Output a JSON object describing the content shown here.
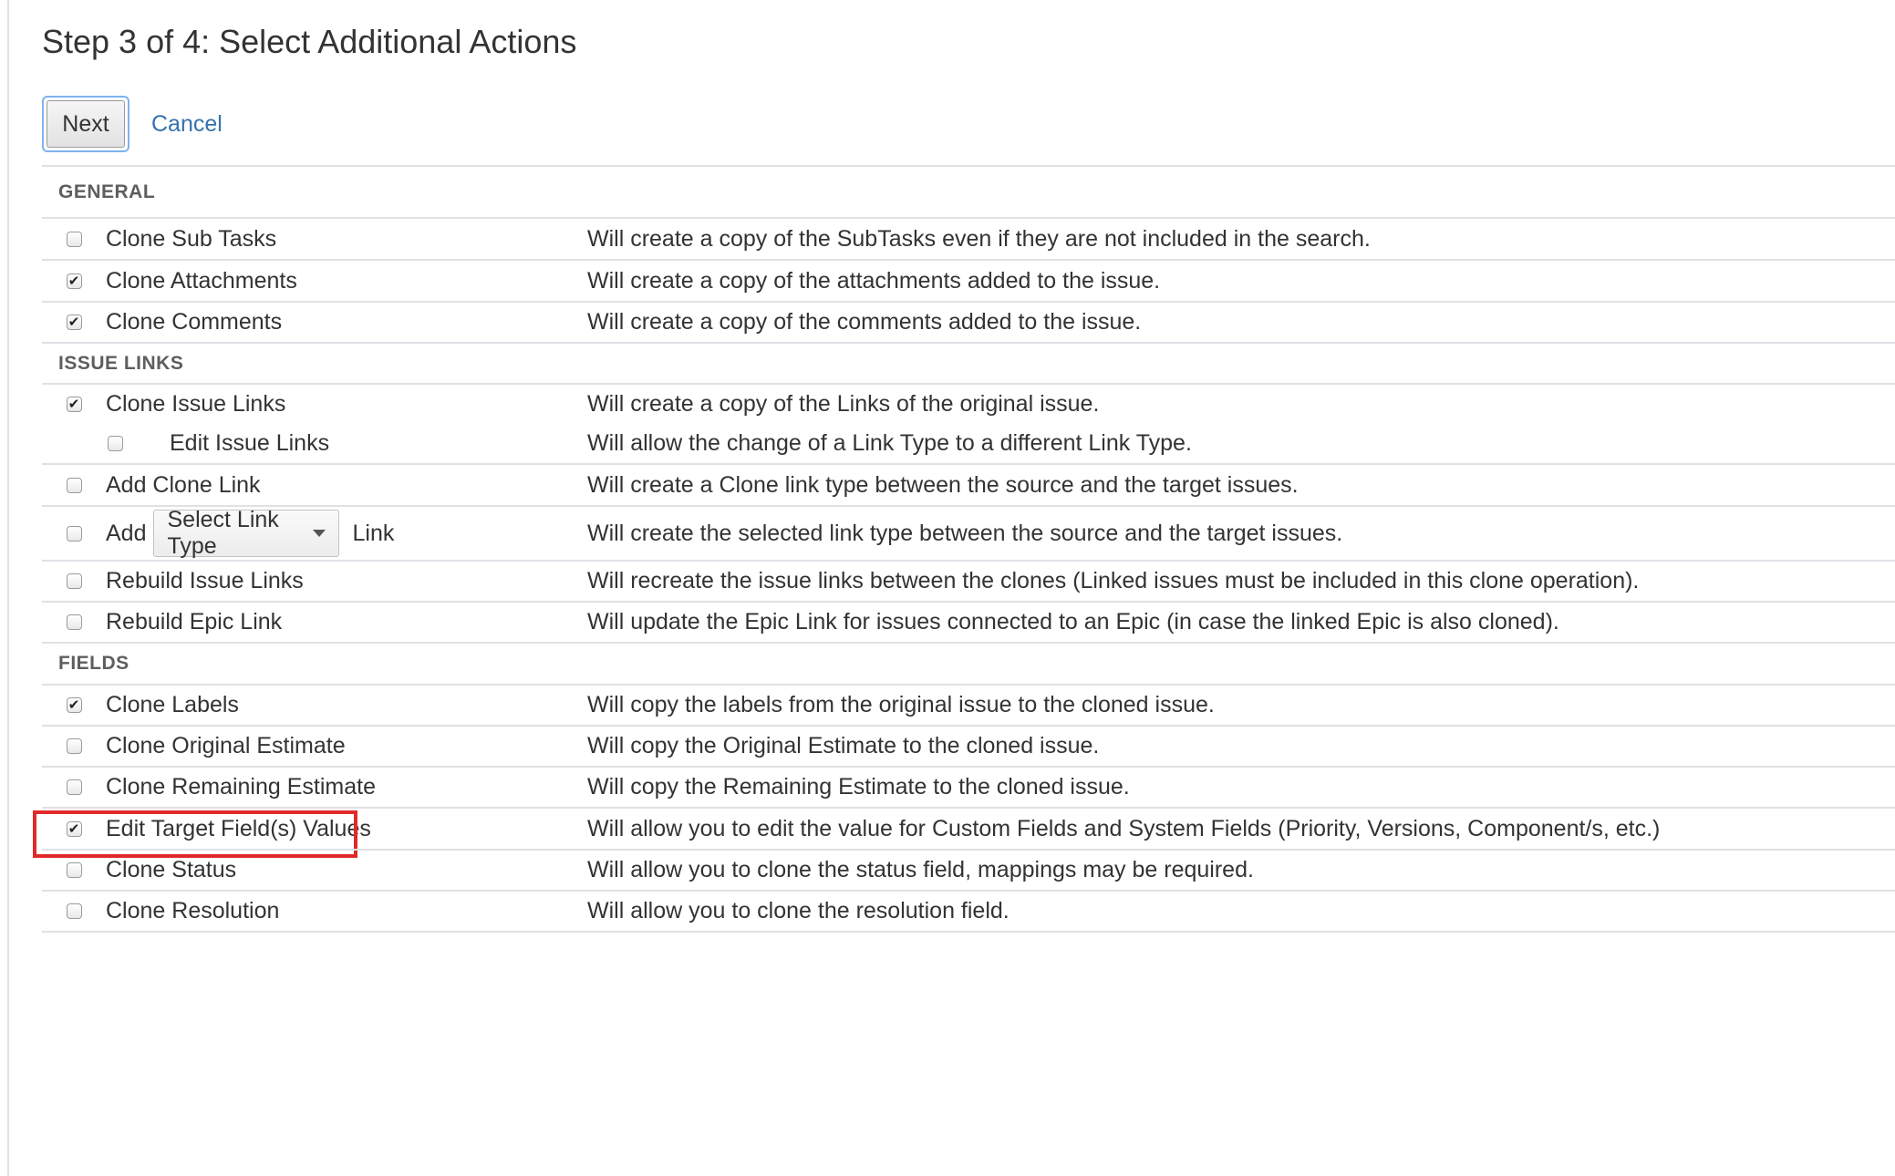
{
  "page": {
    "title": "Step 3 of 4: Select Additional Actions"
  },
  "actions": {
    "next_label": "Next",
    "cancel_label": "Cancel"
  },
  "sections": {
    "general": {
      "header": "GENERAL",
      "rows": [
        {
          "label": "Clone Sub Tasks",
          "checked": false,
          "description": "Will create a copy of the SubTasks even if they are not included in the search."
        },
        {
          "label": "Clone Attachments",
          "checked": true,
          "description": "Will create a copy of the attachments added to the issue."
        },
        {
          "label": "Clone Comments",
          "checked": true,
          "description": "Will create a copy of the comments added to the issue."
        }
      ]
    },
    "issue_links": {
      "header": "ISSUE LINKS",
      "rows": [
        {
          "label": "Clone Issue Links",
          "checked": true,
          "description": "Will create a copy of the Links of the original issue."
        },
        {
          "label": "Edit Issue Links",
          "checked": false,
          "description": "Will allow the change of a Link Type to a different Link Type."
        },
        {
          "label": "Add Clone Link",
          "checked": false,
          "description": "Will create a Clone link type between the source and the target issues."
        },
        {
          "label_prefix": "Add",
          "select_value": "Select Link Type",
          "label_suffix": "Link",
          "checked": false,
          "description": "Will create the selected link type between the source and the target issues."
        },
        {
          "label": "Rebuild Issue Links",
          "checked": false,
          "description": "Will recreate the issue links between the clones (Linked issues must be included in this clone operation)."
        },
        {
          "label": "Rebuild Epic Link",
          "checked": false,
          "description": "Will update the Epic Link for issues connected to an Epic (in case the linked Epic is also cloned)."
        }
      ]
    },
    "fields": {
      "header": "FIELDS",
      "rows": [
        {
          "label": "Clone Labels",
          "checked": true,
          "description": "Will copy the labels from the original issue to the cloned issue."
        },
        {
          "label": "Clone Original Estimate",
          "checked": false,
          "description": "Will copy the Original Estimate to the cloned issue."
        },
        {
          "label": "Clone Remaining Estimate",
          "checked": false,
          "description": "Will copy the Remaining Estimate to the cloned issue."
        },
        {
          "label": "Edit Target Field(s) Values",
          "checked": true,
          "highlighted": true,
          "description": "Will allow you to edit the value for Custom Fields and System Fields (Priority, Versions, Component/s, etc.)"
        },
        {
          "label": "Clone Status",
          "checked": false,
          "description": "Will allow you to clone the status field, mappings may be required."
        },
        {
          "label": "Clone Resolution",
          "checked": false,
          "description": "Will allow you to clone the resolution field."
        }
      ]
    }
  },
  "colors": {
    "link": "#3572b0",
    "highlight": "#e02a2a",
    "focus_ring": "#7fb3f0"
  }
}
